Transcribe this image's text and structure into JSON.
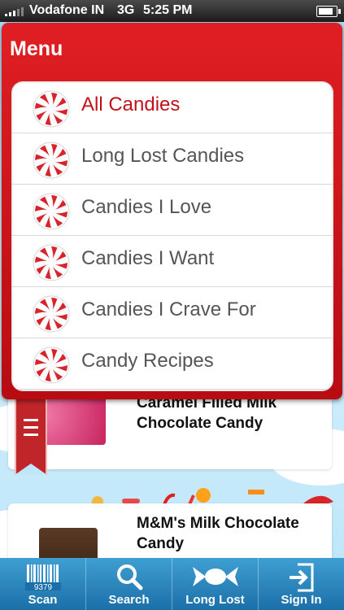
{
  "status_bar": {
    "carrier": "Vodafone IN",
    "network": "3G",
    "time": "5:25 PM"
  },
  "menu": {
    "title": "Menu",
    "items": [
      {
        "label": "All Candies",
        "active": true
      },
      {
        "label": "Long Lost Candies",
        "active": false
      },
      {
        "label": "Candies I Love",
        "active": false
      },
      {
        "label": "Candies I Want",
        "active": false
      },
      {
        "label": "Candies I Crave For",
        "active": false
      },
      {
        "label": "Candy Recipes",
        "active": false
      }
    ]
  },
  "background_list": {
    "cards": [
      {
        "title": "Caramel Filled Milk Chocolate Candy"
      },
      {
        "title": "M&M's Milk Chocolate Candy"
      }
    ]
  },
  "tab_bar": {
    "tabs": [
      {
        "label": "Scan",
        "icon": "barcode-icon",
        "icon_text": "9379"
      },
      {
        "label": "Search",
        "icon": "search-icon"
      },
      {
        "label": "Long Lost",
        "icon": "wrapped-candy-icon"
      },
      {
        "label": "Sign In",
        "icon": "sign-in-icon"
      }
    ]
  },
  "colors": {
    "menu_red": "#d3161c",
    "active_text": "#c1121a",
    "tab_blue": "#2b86be"
  }
}
